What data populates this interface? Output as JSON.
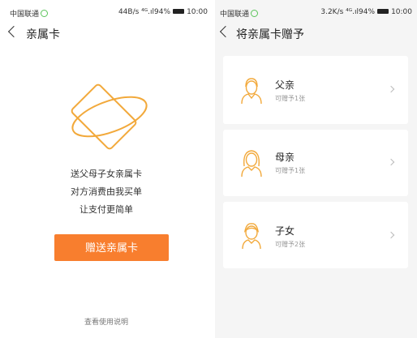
{
  "left_screen": {
    "status_bar": {
      "carrier": "中国联通",
      "speed": "44B/s",
      "battery_pct": "94%",
      "time": "10:00"
    },
    "nav": {
      "title": "亲属卡"
    },
    "slogans": [
      "送父母子女亲属卡",
      "对方消费由我买单",
      "让支付更简单"
    ],
    "gift_button": "赠送亲属卡",
    "help_link": "查看使用说明"
  },
  "right_screen": {
    "status_bar": {
      "carrier": "中国联通",
      "speed": "3.2K/s",
      "battery_pct": "94%",
      "time": "10:00"
    },
    "nav": {
      "title": "将亲属卡赠予"
    },
    "recipients": [
      {
        "name": "父亲",
        "subtitle": "可赠予1张",
        "icon": "father-avatar-icon"
      },
      {
        "name": "母亲",
        "subtitle": "可赠予1张",
        "icon": "mother-avatar-icon"
      },
      {
        "name": "子女",
        "subtitle": "可赠予2张",
        "icon": "child-avatar-icon"
      }
    ]
  },
  "colors": {
    "accent": "#f87e2e",
    "icon_stroke": "#f2a93b",
    "right_bg": "#f5f5f5"
  }
}
